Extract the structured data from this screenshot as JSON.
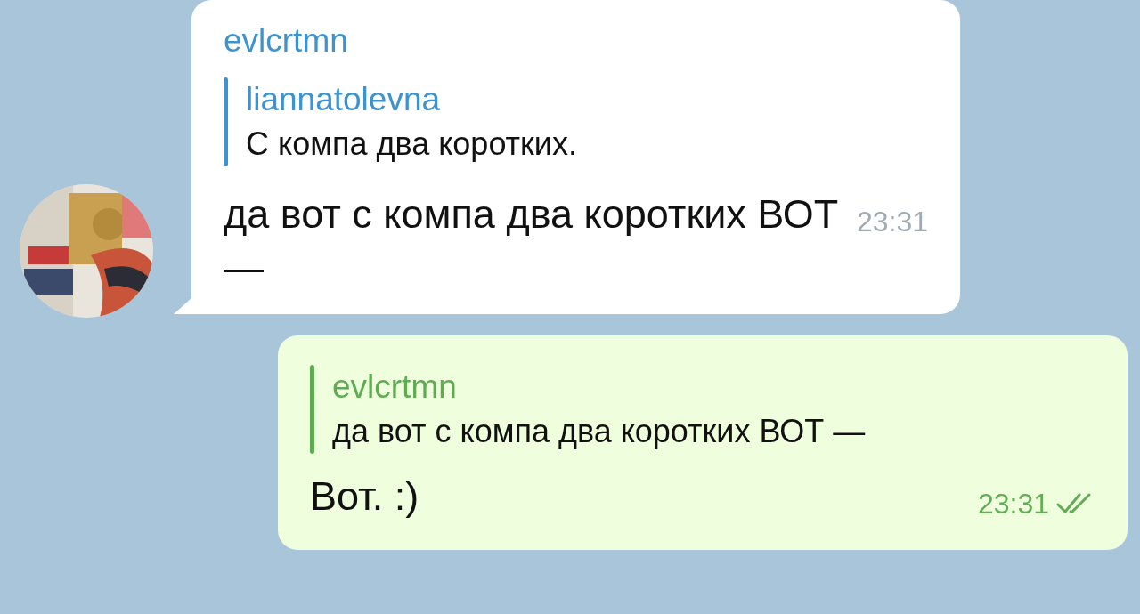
{
  "chat": {
    "messages": [
      {
        "kind": "incoming",
        "sender": "evlcrtmn",
        "reply": {
          "name": "liannatolevna",
          "text": "С компа два коротких."
        },
        "text": "да вот с компа два коротких ВОТ —",
        "time": "23:31"
      },
      {
        "kind": "outgoing",
        "reply": {
          "name": "evlcrtmn",
          "text": "да вот с компа два коротких ВОТ —"
        },
        "text": "Вот. :)",
        "time": "23:31",
        "read": true
      }
    ]
  }
}
